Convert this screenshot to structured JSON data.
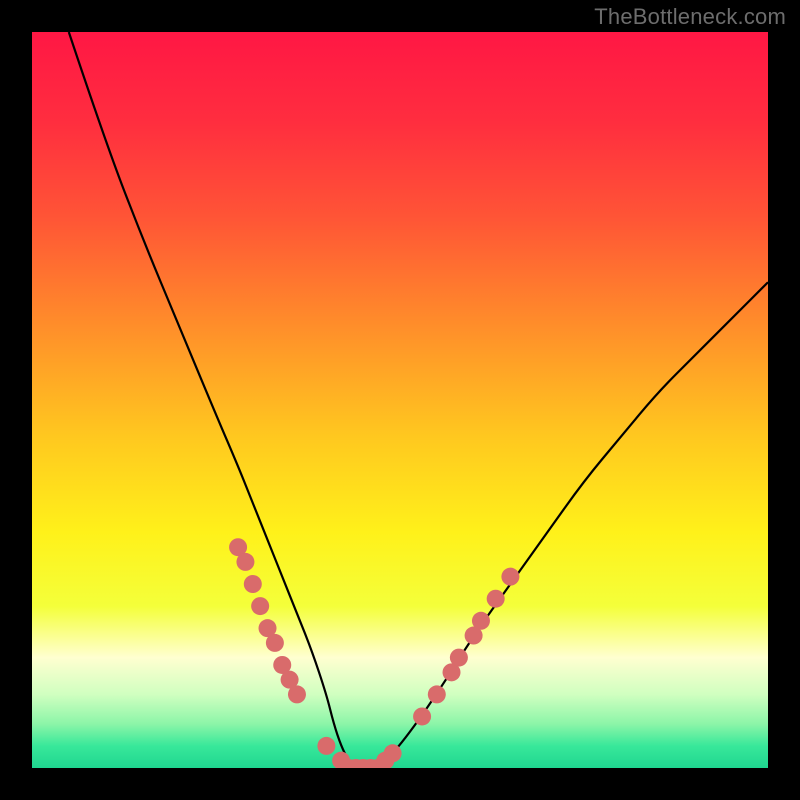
{
  "watermark": "TheBottleneck.com",
  "chart_data": {
    "type": "line",
    "title": "",
    "xlabel": "",
    "ylabel": "",
    "xlim": [
      0,
      100
    ],
    "ylim": [
      0,
      100
    ],
    "series": [
      {
        "name": "bottleneck-curve",
        "x": [
          5,
          10,
          15,
          20,
          25,
          28,
          30,
          32,
          34,
          36,
          38,
          40,
          41,
          42,
          43,
          44,
          45,
          47,
          50,
          55,
          60,
          65,
          70,
          75,
          80,
          85,
          90,
          95,
          100
        ],
        "y": [
          100,
          85,
          72,
          60,
          48,
          41,
          36,
          31,
          26,
          21,
          16,
          10,
          6,
          3,
          1,
          0,
          0,
          0,
          3,
          10,
          18,
          25,
          32,
          39,
          45,
          51,
          56,
          61,
          66
        ]
      }
    ],
    "marker_clusters": [
      {
        "name": "left-cluster",
        "points": [
          {
            "x": 28,
            "y": 30
          },
          {
            "x": 29,
            "y": 28
          },
          {
            "x": 30,
            "y": 25
          },
          {
            "x": 31,
            "y": 22
          },
          {
            "x": 32,
            "y": 19
          },
          {
            "x": 33,
            "y": 17
          },
          {
            "x": 34,
            "y": 14
          },
          {
            "x": 35,
            "y": 12
          },
          {
            "x": 36,
            "y": 10
          }
        ]
      },
      {
        "name": "bottom-cluster",
        "points": [
          {
            "x": 40,
            "y": 3
          },
          {
            "x": 42,
            "y": 1
          },
          {
            "x": 43,
            "y": 0
          },
          {
            "x": 44,
            "y": 0
          },
          {
            "x": 45,
            "y": 0
          },
          {
            "x": 46,
            "y": 0
          },
          {
            "x": 47,
            "y": 0
          },
          {
            "x": 48,
            "y": 1
          },
          {
            "x": 49,
            "y": 2
          }
        ]
      },
      {
        "name": "right-cluster",
        "points": [
          {
            "x": 53,
            "y": 7
          },
          {
            "x": 55,
            "y": 10
          },
          {
            "x": 57,
            "y": 13
          },
          {
            "x": 58,
            "y": 15
          },
          {
            "x": 60,
            "y": 18
          },
          {
            "x": 61,
            "y": 20
          },
          {
            "x": 63,
            "y": 23
          },
          {
            "x": 65,
            "y": 26
          }
        ]
      }
    ],
    "gradient_stops": [
      {
        "offset": 0.0,
        "color": "#ff1744"
      },
      {
        "offset": 0.12,
        "color": "#ff2d3f"
      },
      {
        "offset": 0.25,
        "color": "#ff5436"
      },
      {
        "offset": 0.4,
        "color": "#ff8e2a"
      },
      {
        "offset": 0.55,
        "color": "#ffc81f"
      },
      {
        "offset": 0.68,
        "color": "#fff11a"
      },
      {
        "offset": 0.78,
        "color": "#f4ff3a"
      },
      {
        "offset": 0.85,
        "color": "#ffffd0"
      },
      {
        "offset": 0.9,
        "color": "#d0ffc0"
      },
      {
        "offset": 0.94,
        "color": "#8cf5a8"
      },
      {
        "offset": 0.97,
        "color": "#38e89a"
      },
      {
        "offset": 1.0,
        "color": "#1fd690"
      }
    ],
    "marker_color": "#d96b6b",
    "curve_color": "#000000"
  }
}
